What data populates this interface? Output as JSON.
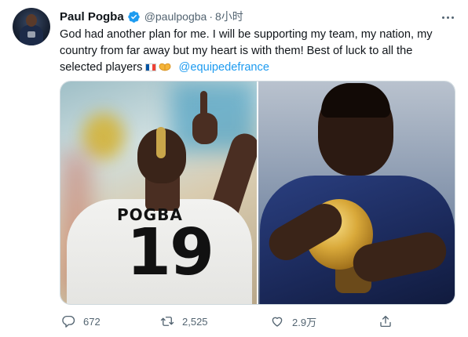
{
  "tweet": {
    "display_name": "Paul Pogba",
    "handle": "@paulpogba",
    "separator": "·",
    "timestamp": "8小时",
    "text_line_1": "God had another plan for me. I will be supporting my team, my nation, my",
    "text_line_2": "country from far away but my heart is with them! Best of luck to all the",
    "text_line_3": "selected players",
    "mention": "@equipedefrance",
    "emojis": [
      "flag-france",
      "heart-hands"
    ],
    "photos": [
      {
        "shirt_name": "POGBA",
        "shirt_number": "19"
      },
      {
        "subject": "player-kissing-world-cup-trophy"
      }
    ]
  },
  "actions": {
    "reply_count": "672",
    "retweet_count": "2,525",
    "like_count": "2.9万",
    "share_count": ""
  },
  "icons": [
    "verified-badge-icon",
    "more-icon",
    "reply-icon",
    "retweet-icon",
    "like-icon",
    "share-icon"
  ],
  "colors": {
    "accent": "#1d9bf0",
    "text_primary": "#0f1419",
    "text_secondary": "#536471",
    "border": "#cfd9de"
  }
}
